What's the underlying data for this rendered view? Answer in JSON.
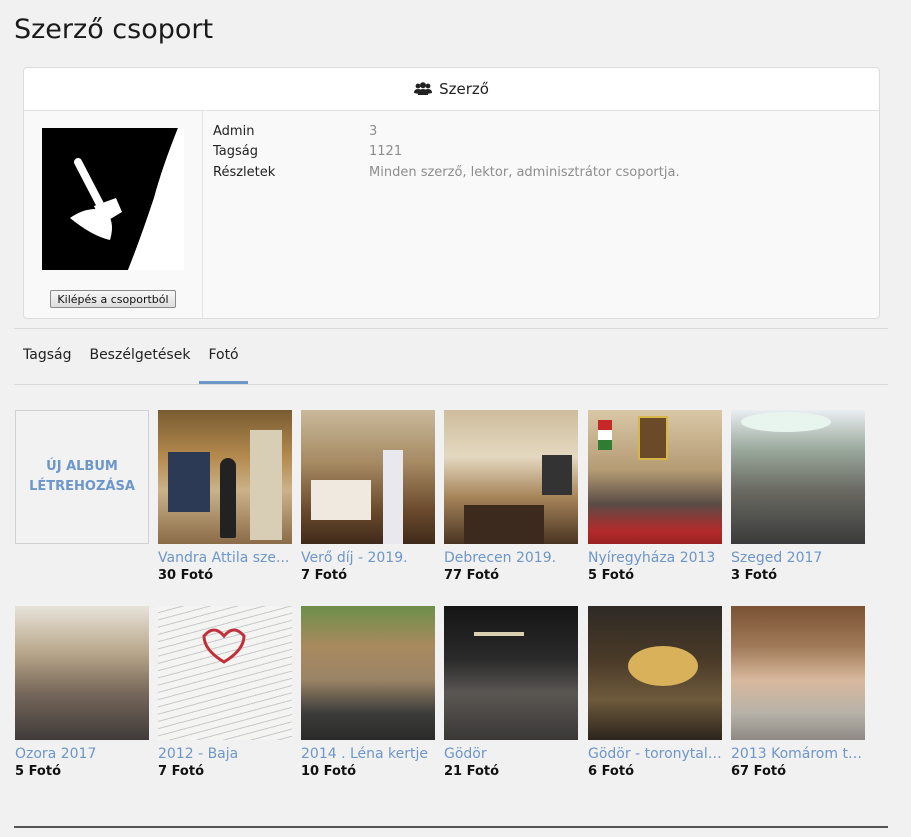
{
  "page": {
    "title": "Szerző csoport"
  },
  "group": {
    "name": "Szerző",
    "leave_label": "Kilépés a csoportból",
    "info": [
      {
        "key": "Admin",
        "value": "3"
      },
      {
        "key": "Tagság",
        "value": "1121"
      },
      {
        "key": "Részletek",
        "value": "Minden szerző, lektor, adminisztrátor csoportja."
      }
    ]
  },
  "tabs": [
    {
      "label": "Tagság",
      "active": false
    },
    {
      "label": "Beszélgetések",
      "active": false
    },
    {
      "label": "Fotó",
      "active": true
    }
  ],
  "new_album": {
    "line1": "ÚJ ALBUM",
    "line2": "LÉTREHOZÁSA"
  },
  "albums": [
    {
      "title": "Vandra Attila sze...",
      "count": "30 Fotó"
    },
    {
      "title": "Verő díj - 2019.",
      "count": "7 Fotó"
    },
    {
      "title": "Debrecen 2019.",
      "count": "77 Fotó"
    },
    {
      "title": "Nyíregyháza 2013",
      "count": "5 Fotó"
    },
    {
      "title": "Szeged 2017",
      "count": "3 Fotó"
    },
    {
      "title": "Ozora 2017",
      "count": "5 Fotó"
    },
    {
      "title": "2012 - Baja",
      "count": "7 Fotó"
    },
    {
      "title": "2014 . Léna kertje",
      "count": "10 Fotó"
    },
    {
      "title": "Gödör",
      "count": "21 Fotó"
    },
    {
      "title": "Gödör - toronytalá...",
      "count": "6 Fotó"
    },
    {
      "title": "2013 Komárom tor...",
      "count": "67 Fotó"
    }
  ],
  "colors": {
    "accent": "#6d96c9",
    "tab_underline": "#6d96c9"
  }
}
